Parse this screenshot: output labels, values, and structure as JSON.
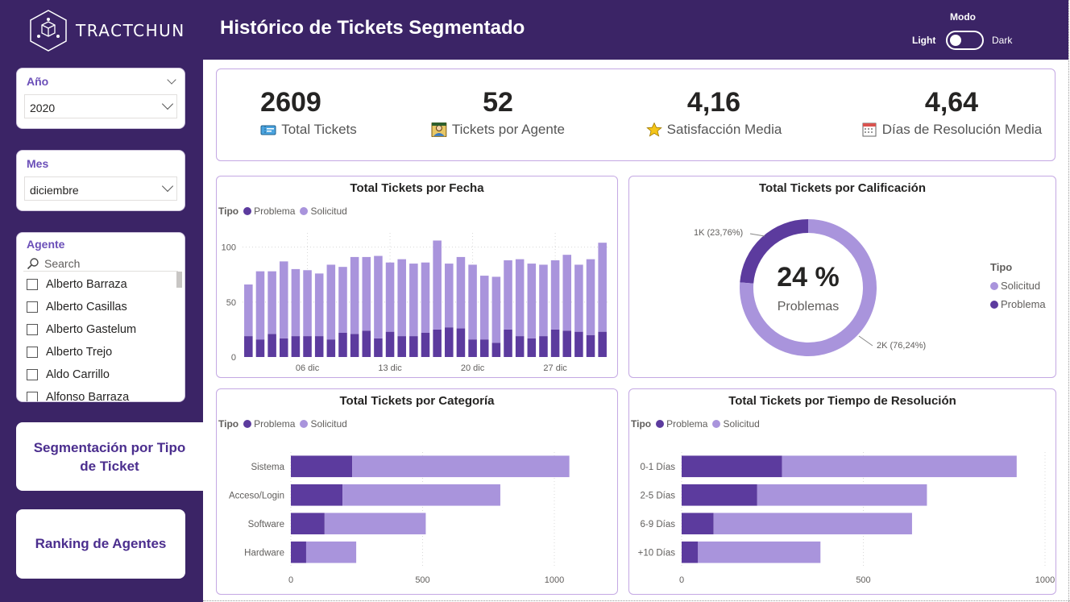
{
  "brand": {
    "name": "TRACTCHUN"
  },
  "header": {
    "title": "Histórico de Tickets Segmentado",
    "mode_label": "Modo",
    "light_label": "Light",
    "dark_label": "Dark"
  },
  "colors": {
    "primary": "#3b2466",
    "problema": "#5c3b9e",
    "solicitud": "#a994dc",
    "border": "#c4a8e3"
  },
  "filters": {
    "year": {
      "title": "Año",
      "value": "2020"
    },
    "month": {
      "title": "Mes",
      "value": "diciembre"
    },
    "agent": {
      "title": "Agente",
      "search_placeholder": "Search",
      "items": [
        "Alberto Barraza",
        "Alberto Casillas",
        "Alberto Gastelum",
        "Alberto Trejo",
        "Aldo Carrillo",
        "Alfonso Barraza"
      ]
    }
  },
  "nav": {
    "segmentacion": "Segmentación por Tipo de Ticket",
    "ranking": "Ranking de Agentes"
  },
  "kpis": [
    {
      "value": "2609",
      "label": "Total Tickets",
      "icon": "ticket-icon"
    },
    {
      "value": "52",
      "label": "Tickets por Agente",
      "icon": "agent-icon"
    },
    {
      "value": "4,16",
      "label": "Satisfacción Media",
      "icon": "star-icon"
    },
    {
      "value": "4,64",
      "label": "Días de Resolución Media",
      "icon": "calendar-icon"
    }
  ],
  "legend": {
    "title": "Tipo",
    "problema": "Problema",
    "solicitud": "Solicitud"
  },
  "chart_data": [
    {
      "type": "bar",
      "stacked": true,
      "title": "Total Tickets por Fecha",
      "x_tick_labels": [
        "06 dic",
        "13 dic",
        "20 dic",
        "27 dic"
      ],
      "x_tick_days": [
        6,
        13,
        20,
        27
      ],
      "y_ticks": [
        0,
        50,
        100
      ],
      "ylim": [
        0,
        110
      ],
      "x": [
        1,
        2,
        3,
        4,
        5,
        6,
        7,
        8,
        9,
        10,
        11,
        12,
        13,
        14,
        15,
        16,
        17,
        18,
        19,
        20,
        21,
        22,
        23,
        24,
        25,
        26,
        27,
        28,
        29,
        30,
        31
      ],
      "series": [
        {
          "name": "Problema",
          "values": [
            19,
            16,
            21,
            17,
            19,
            19,
            19,
            16,
            22,
            21,
            24,
            17,
            23,
            19,
            19,
            22,
            25,
            27,
            26,
            16,
            16,
            13,
            25,
            19,
            17,
            19,
            25,
            24,
            23,
            20,
            23
          ]
        },
        {
          "name": "Solicitud",
          "values": [
            47,
            62,
            57,
            70,
            61,
            60,
            57,
            68,
            60,
            70,
            67,
            75,
            63,
            70,
            66,
            64,
            81,
            58,
            65,
            68,
            58,
            60,
            63,
            70,
            68,
            65,
            63,
            69,
            61,
            69,
            81
          ]
        }
      ]
    },
    {
      "type": "pie",
      "donut": true,
      "title": "Total Tickets por Calificación",
      "center_value": "24 %",
      "center_label": "Problemas",
      "slices": [
        {
          "name": "Problema",
          "value": 23.76,
          "label": "1K (23,76%)"
        },
        {
          "name": "Solicitud",
          "value": 76.24,
          "label": "2K (76,24%)"
        }
      ],
      "legend_order": [
        "Solicitud",
        "Problema"
      ]
    },
    {
      "type": "bar",
      "orientation": "horizontal",
      "stacked": true,
      "title": "Total Tickets por Categoría",
      "categories": [
        "Sistema",
        "Acceso/Login",
        "Software",
        "Hardware"
      ],
      "x_ticks": [
        0,
        500,
        1000
      ],
      "xlim": [
        0,
        1000
      ],
      "series": [
        {
          "name": "Problema",
          "values": [
            233,
            196,
            128,
            58
          ]
        },
        {
          "name": "Solicitud",
          "values": [
            824,
            599,
            384,
            190
          ]
        }
      ]
    },
    {
      "type": "bar",
      "orientation": "horizontal",
      "stacked": true,
      "title": "Total Tickets por Tiempo de Resolución",
      "categories": [
        "0-1 Días",
        "2-5 Días",
        "6-9 Días",
        "+10 Días"
      ],
      "x_ticks": [
        0,
        500,
        1000
      ],
      "xlim": [
        0,
        1000
      ],
      "series": [
        {
          "name": "Problema",
          "values": [
            276,
            208,
            88,
            45
          ]
        },
        {
          "name": "Solicitud",
          "values": [
            646,
            467,
            546,
            337
          ]
        }
      ]
    }
  ]
}
